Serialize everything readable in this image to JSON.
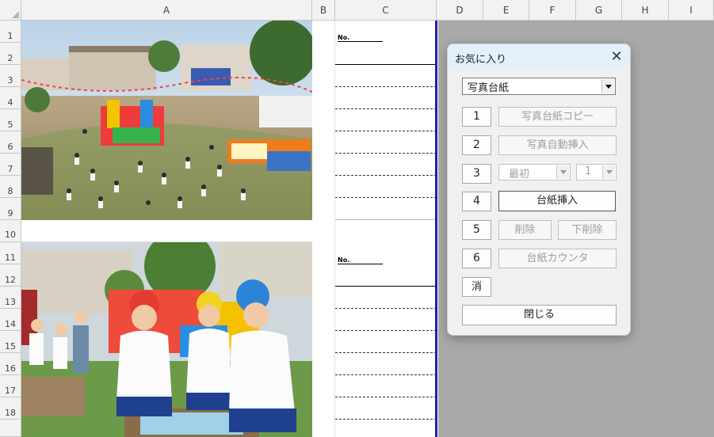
{
  "sheet": {
    "columns": [
      "A",
      "B",
      "C",
      "D",
      "E",
      "F",
      "G",
      "H",
      "I"
    ],
    "rows": [
      "1",
      "2",
      "3",
      "4",
      "5",
      "6",
      "7",
      "8",
      "9",
      "10",
      "11",
      "12",
      "13",
      "14",
      "15",
      "16",
      "17",
      "18"
    ],
    "number_label": "No."
  },
  "dialog": {
    "title": "お気に入り",
    "close_glyph": "✕",
    "template_select": "写真台紙",
    "buttons": [
      {
        "num": "1",
        "label": "写真台紙コピー",
        "enabled": false
      },
      {
        "num": "2",
        "label": "写真自動挿入",
        "enabled": false
      },
      {
        "num": "4",
        "label": "台紙挿入",
        "enabled": true
      },
      {
        "num": "5",
        "label": "削除",
        "enabled": false
      },
      {
        "num": "6",
        "label": "台紙カウンタ",
        "enabled": false
      }
    ],
    "row3": {
      "num": "3",
      "first_select": "最初",
      "count_select": "1"
    },
    "delete_extra_label": "下削除",
    "clear_label": "消",
    "close_label": "閉じる"
  },
  "colors": {
    "highlight": "#e2161b",
    "print_border": "#1f1fa8",
    "title_bar": "#e3f0fb"
  },
  "icons": {
    "close": "close-icon",
    "dropdown": "chevron-down-icon"
  }
}
